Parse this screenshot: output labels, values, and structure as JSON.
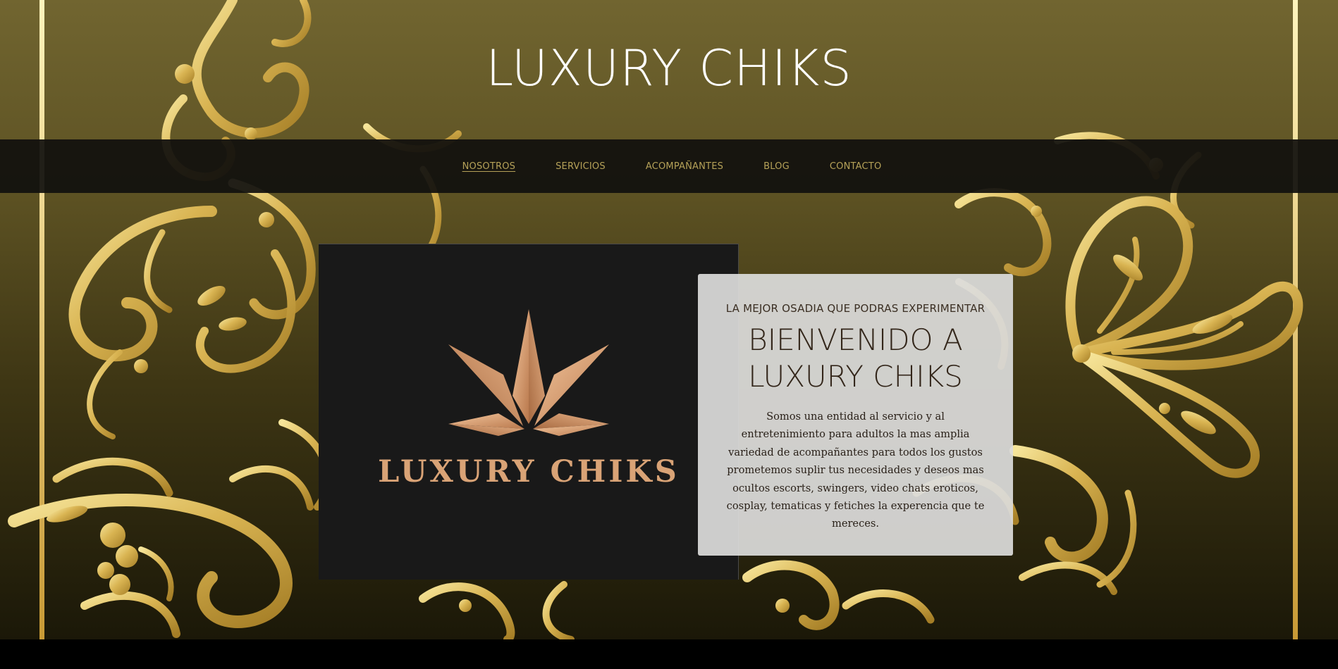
{
  "header": {
    "site_title": "LUXURY CHIKS"
  },
  "nav": {
    "items": [
      {
        "label": "NOSOTROS",
        "active": true
      },
      {
        "label": "SERVICIOS",
        "active": false
      },
      {
        "label": "ACOMPAÑANTES",
        "active": false
      },
      {
        "label": "BLOG",
        "active": false
      },
      {
        "label": "CONTACTO",
        "active": false
      }
    ]
  },
  "logo": {
    "brand_text": "LUXURY CHIKS",
    "icon": "five-point-star-crown-icon"
  },
  "welcome": {
    "tagline": "LA MEJOR OSADIA QUE PODRAS EXPERIMENTAR",
    "heading_line1": "BIENVENIDO A",
    "heading_line2": "LUXURY CHIKS",
    "description": "Somos una entidad al servicio y al entretenimiento para adultos la mas amplia variedad de acompañantes para todos los gustos prometemos suplir tus necesidades y deseos mas ocultos escorts, swingers, video chats eroticos, cosplay, tematicas y fetiches la experencia que te mereces."
  },
  "colors": {
    "background_top": "#716530",
    "background_bottom": "#1b1808",
    "gold": "#e7c667",
    "nav_text": "#b5a158",
    "nav_bar": "#11100e",
    "logo_bg": "#191919",
    "logo_copper": "#d9a376",
    "card_bg": "#dcdcda",
    "card_text": "#33261a"
  }
}
